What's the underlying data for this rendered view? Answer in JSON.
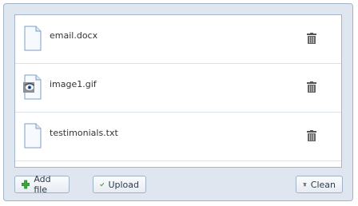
{
  "files": [
    {
      "name": "email.docx",
      "icon": "document-icon"
    },
    {
      "name": "image1.gif",
      "icon": "image-file-icon"
    },
    {
      "name": "testimonials.txt",
      "icon": "document-icon"
    }
  ],
  "toolbar": {
    "add_label": "Add file",
    "upload_label": "Upload",
    "clean_label": "Clean"
  },
  "colors": {
    "panel_bg": "#dfe6f0",
    "border": "#a3b4c8",
    "add_icon": "#3aa63a",
    "upload_icon": "#4c9a2a"
  }
}
